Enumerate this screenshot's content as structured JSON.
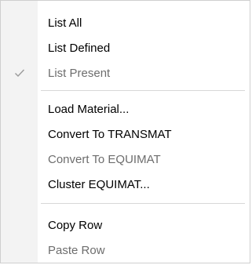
{
  "menu": {
    "items": [
      {
        "label": "List All",
        "enabled": true,
        "checked": false
      },
      {
        "label": "List Defined",
        "enabled": true,
        "checked": false
      },
      {
        "label": "List Present",
        "enabled": false,
        "checked": true
      },
      {
        "label": "Load Material...",
        "enabled": true,
        "checked": false
      },
      {
        "label": "Convert To TRANSMAT",
        "enabled": true,
        "checked": false
      },
      {
        "label": "Convert To EQUIMAT",
        "enabled": false,
        "checked": false
      },
      {
        "label": "Cluster EQUIMAT...",
        "enabled": true,
        "checked": false
      },
      {
        "label": "Copy Row",
        "enabled": true,
        "checked": false
      },
      {
        "label": "Paste Row",
        "enabled": false,
        "checked": false
      }
    ],
    "check_icon": "checkmark-icon",
    "colors": {
      "background": "#ffffff",
      "gutter": "#f3f3f3",
      "text": "#000000",
      "disabled_text": "#6d6d6d",
      "separator": "#d7d7d7",
      "checkmark": "#9a9a9a"
    }
  }
}
